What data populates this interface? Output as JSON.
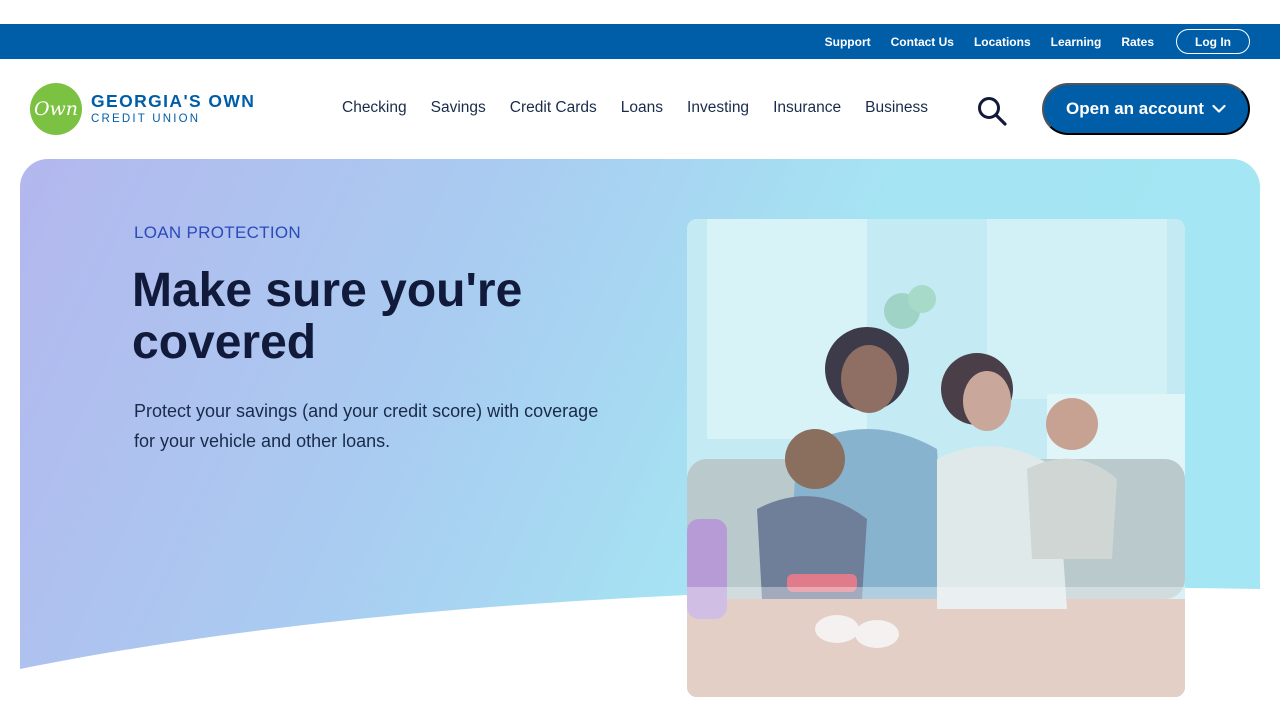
{
  "utility": {
    "links": [
      "Support",
      "Contact Us",
      "Locations",
      "Learning",
      "Rates"
    ],
    "login_label": "Log In"
  },
  "brand": {
    "mark": "Own",
    "name": "GEORGIA'S OWN",
    "sub": "CREDIT UNION",
    "colors": {
      "primary": "#005ea8",
      "green": "#7cc242"
    }
  },
  "nav": {
    "items": [
      "Checking",
      "Savings",
      "Credit Cards",
      "Loans",
      "Investing",
      "Insurance",
      "Business"
    ],
    "search_icon": "search-icon",
    "cta_label": "Open an account"
  },
  "hero": {
    "eyebrow": "LOAN PROTECTION",
    "title": "Make sure you're covered",
    "description": "Protect your savings (and your credit score) with coverage for your vehicle and other loans."
  }
}
